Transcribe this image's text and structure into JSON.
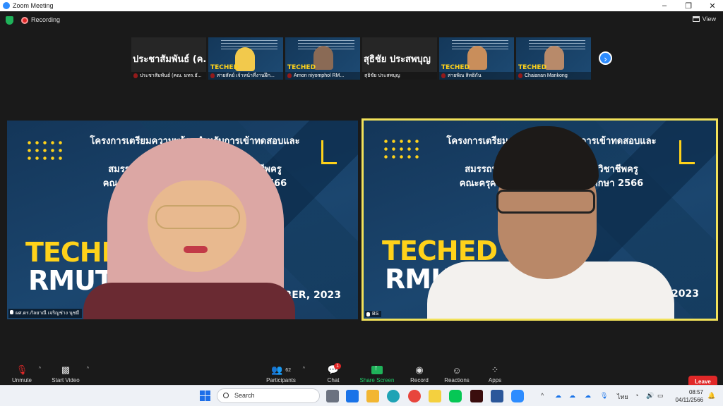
{
  "window": {
    "title": "Zoom Meeting",
    "controls": [
      "–",
      "❐",
      "✕"
    ]
  },
  "status": {
    "recording_label": "Recording",
    "view_label": "View"
  },
  "thumbnails": [
    {
      "name": "ประชาสัมพันธ์ (คณ. มทร.ธั...",
      "big_name": "ประชาสัมพันธ์ (ค...",
      "type": "name"
    },
    {
      "name": "สายสัตย์ เจ้าหน้าที่งานฝึก...",
      "type": "slide"
    },
    {
      "name": "Arnon niyomphol RM...",
      "type": "slide"
    },
    {
      "name": "สุธิชัย ประสพบุญ",
      "big_name": "สุธิชัย ประสพบุญ",
      "type": "name"
    },
    {
      "name": "สายพิณ สิทธิกัน",
      "type": "slide"
    },
    {
      "name": "Chaianan Mankong",
      "type": "slide"
    }
  ],
  "slide": {
    "title": "โครงการเตรียมความพร้อมสำหรับการเข้าทดสอบและประเมิน\nสมรรถนะทางวิชาชีพของนักศึกษาวิชาชีพครู\nคณะครุศาสตร์อุตสาหกรรม ปีการศึกษา 2566",
    "title_left": "โครงการเตรียมความพร้อมสำหรับการเข้าทดสอบและประเมิน\nสมรรถนะทางวิชาชีพของนักศึกษาวิชาชีพครู\nคณะครุศาสตร์อุตสาหกรรม ปีการศึกษา 2566",
    "teched": "TECHED",
    "rmutt": "RMUTT",
    "date": "MBER, 2023",
    "thumb_teched": "TECHED",
    "thumb_rmutt": "RMUTT"
  },
  "videos": {
    "left_name": "ผศ.ดร.กัลยาณี เจริญช่าง นุชมี",
    "right_name": "BS"
  },
  "toolbar": {
    "unmute": "Unmute",
    "start_video": "Start Video",
    "participants": "Participants",
    "participants_count": "62",
    "chat": "Chat",
    "chat_badge": "1",
    "share": "Share Screen",
    "record": "Record",
    "reactions": "Reactions",
    "apps": "Apps",
    "leave": "Leave"
  },
  "taskbar": {
    "search_placeholder": "Search",
    "lang": "ไทย",
    "time": "08:57",
    "date": "04/11/2566"
  }
}
